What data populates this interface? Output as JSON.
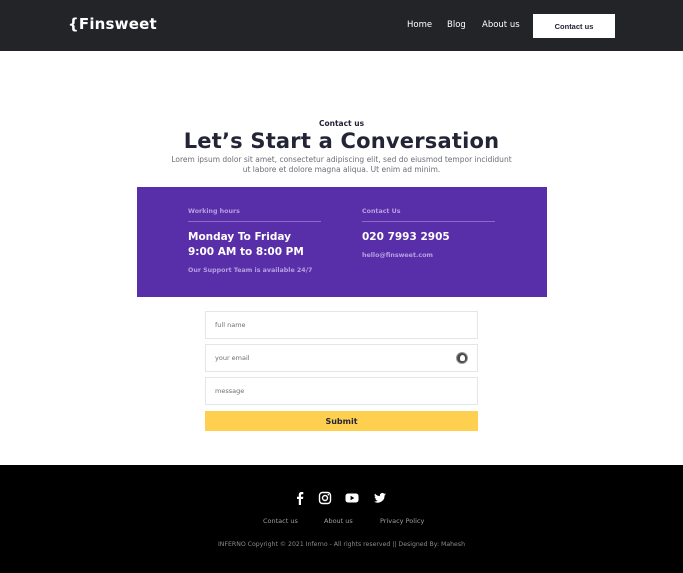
{
  "nav": {
    "logo": "{Finsweet",
    "links": [
      "Home",
      "Blog",
      "About us"
    ],
    "cta": "Contact us"
  },
  "hero": {
    "eyebrow": "Contact us",
    "title": "Let’s Start a Conversation",
    "intro": "Lorem ipsum dolor sit amet, consectetur adipiscing elit, sed do eiusmod tempor incididunt ut labore et dolore magna aliqua. Ut enim ad minim."
  },
  "info": {
    "hours_label": "Working hours",
    "hours_line1": "Monday To Friday",
    "hours_line2": "9:00 AM to 8:00 PM",
    "hours_note": "Our Support Team is available 24/7",
    "contact_label": "Contact Us",
    "phone": "020 7993 2905",
    "email": "hello@finsweet.com"
  },
  "form": {
    "name_placeholder": "full name",
    "email_placeholder": "your email",
    "message_placeholder": "message",
    "submit_label": "Submit"
  },
  "footer": {
    "social_icons": [
      "facebook-icon",
      "instagram-icon",
      "youtube-icon",
      "twitter-icon"
    ],
    "links": [
      "Contact us",
      "About us",
      "Privacy Policy"
    ],
    "copyright": "INFERNO Copyright © 2021 Inferno - All rights reserved || Designed By: Mahesh"
  },
  "colors": {
    "nav_bg": "#232428",
    "accent_purple": "#592ea9",
    "submit_yellow": "#ffd050",
    "footer_bg": "#000000"
  }
}
